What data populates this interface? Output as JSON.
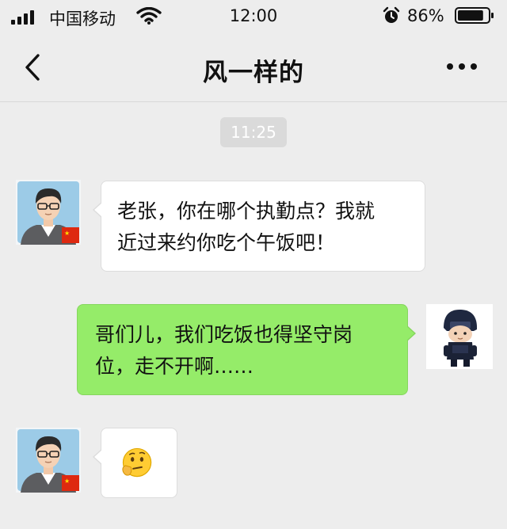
{
  "status_bar": {
    "carrier": "中国移动",
    "time": "12:00",
    "battery_percent": "86%",
    "battery_level": 0.86,
    "icons": [
      "signal-icon",
      "wifi-icon",
      "alarm-icon",
      "battery-icon"
    ]
  },
  "nav": {
    "title": "风一样的",
    "back_icon": "chevron-left-icon",
    "more_icon": "more-horizontal-icon"
  },
  "chat": {
    "timestamp": "11:25",
    "messages": [
      {
        "side": "left",
        "lines": [
          "老张，你在哪个执勤点？我就",
          "近过来约你吃个午饭吧！"
        ]
      },
      {
        "side": "right",
        "lines": [
          "哥们儿，我们吃饭也得坚守岗",
          "位，走不开啊……"
        ]
      },
      {
        "side": "left",
        "emoji": "🤔",
        "emoji_name": "thinking-face-emoji"
      }
    ]
  },
  "colors": {
    "background": "#ededed",
    "outgoing_bubble": "#95ec69",
    "incoming_bubble": "#ffffff",
    "time_chip": "#dadada"
  }
}
